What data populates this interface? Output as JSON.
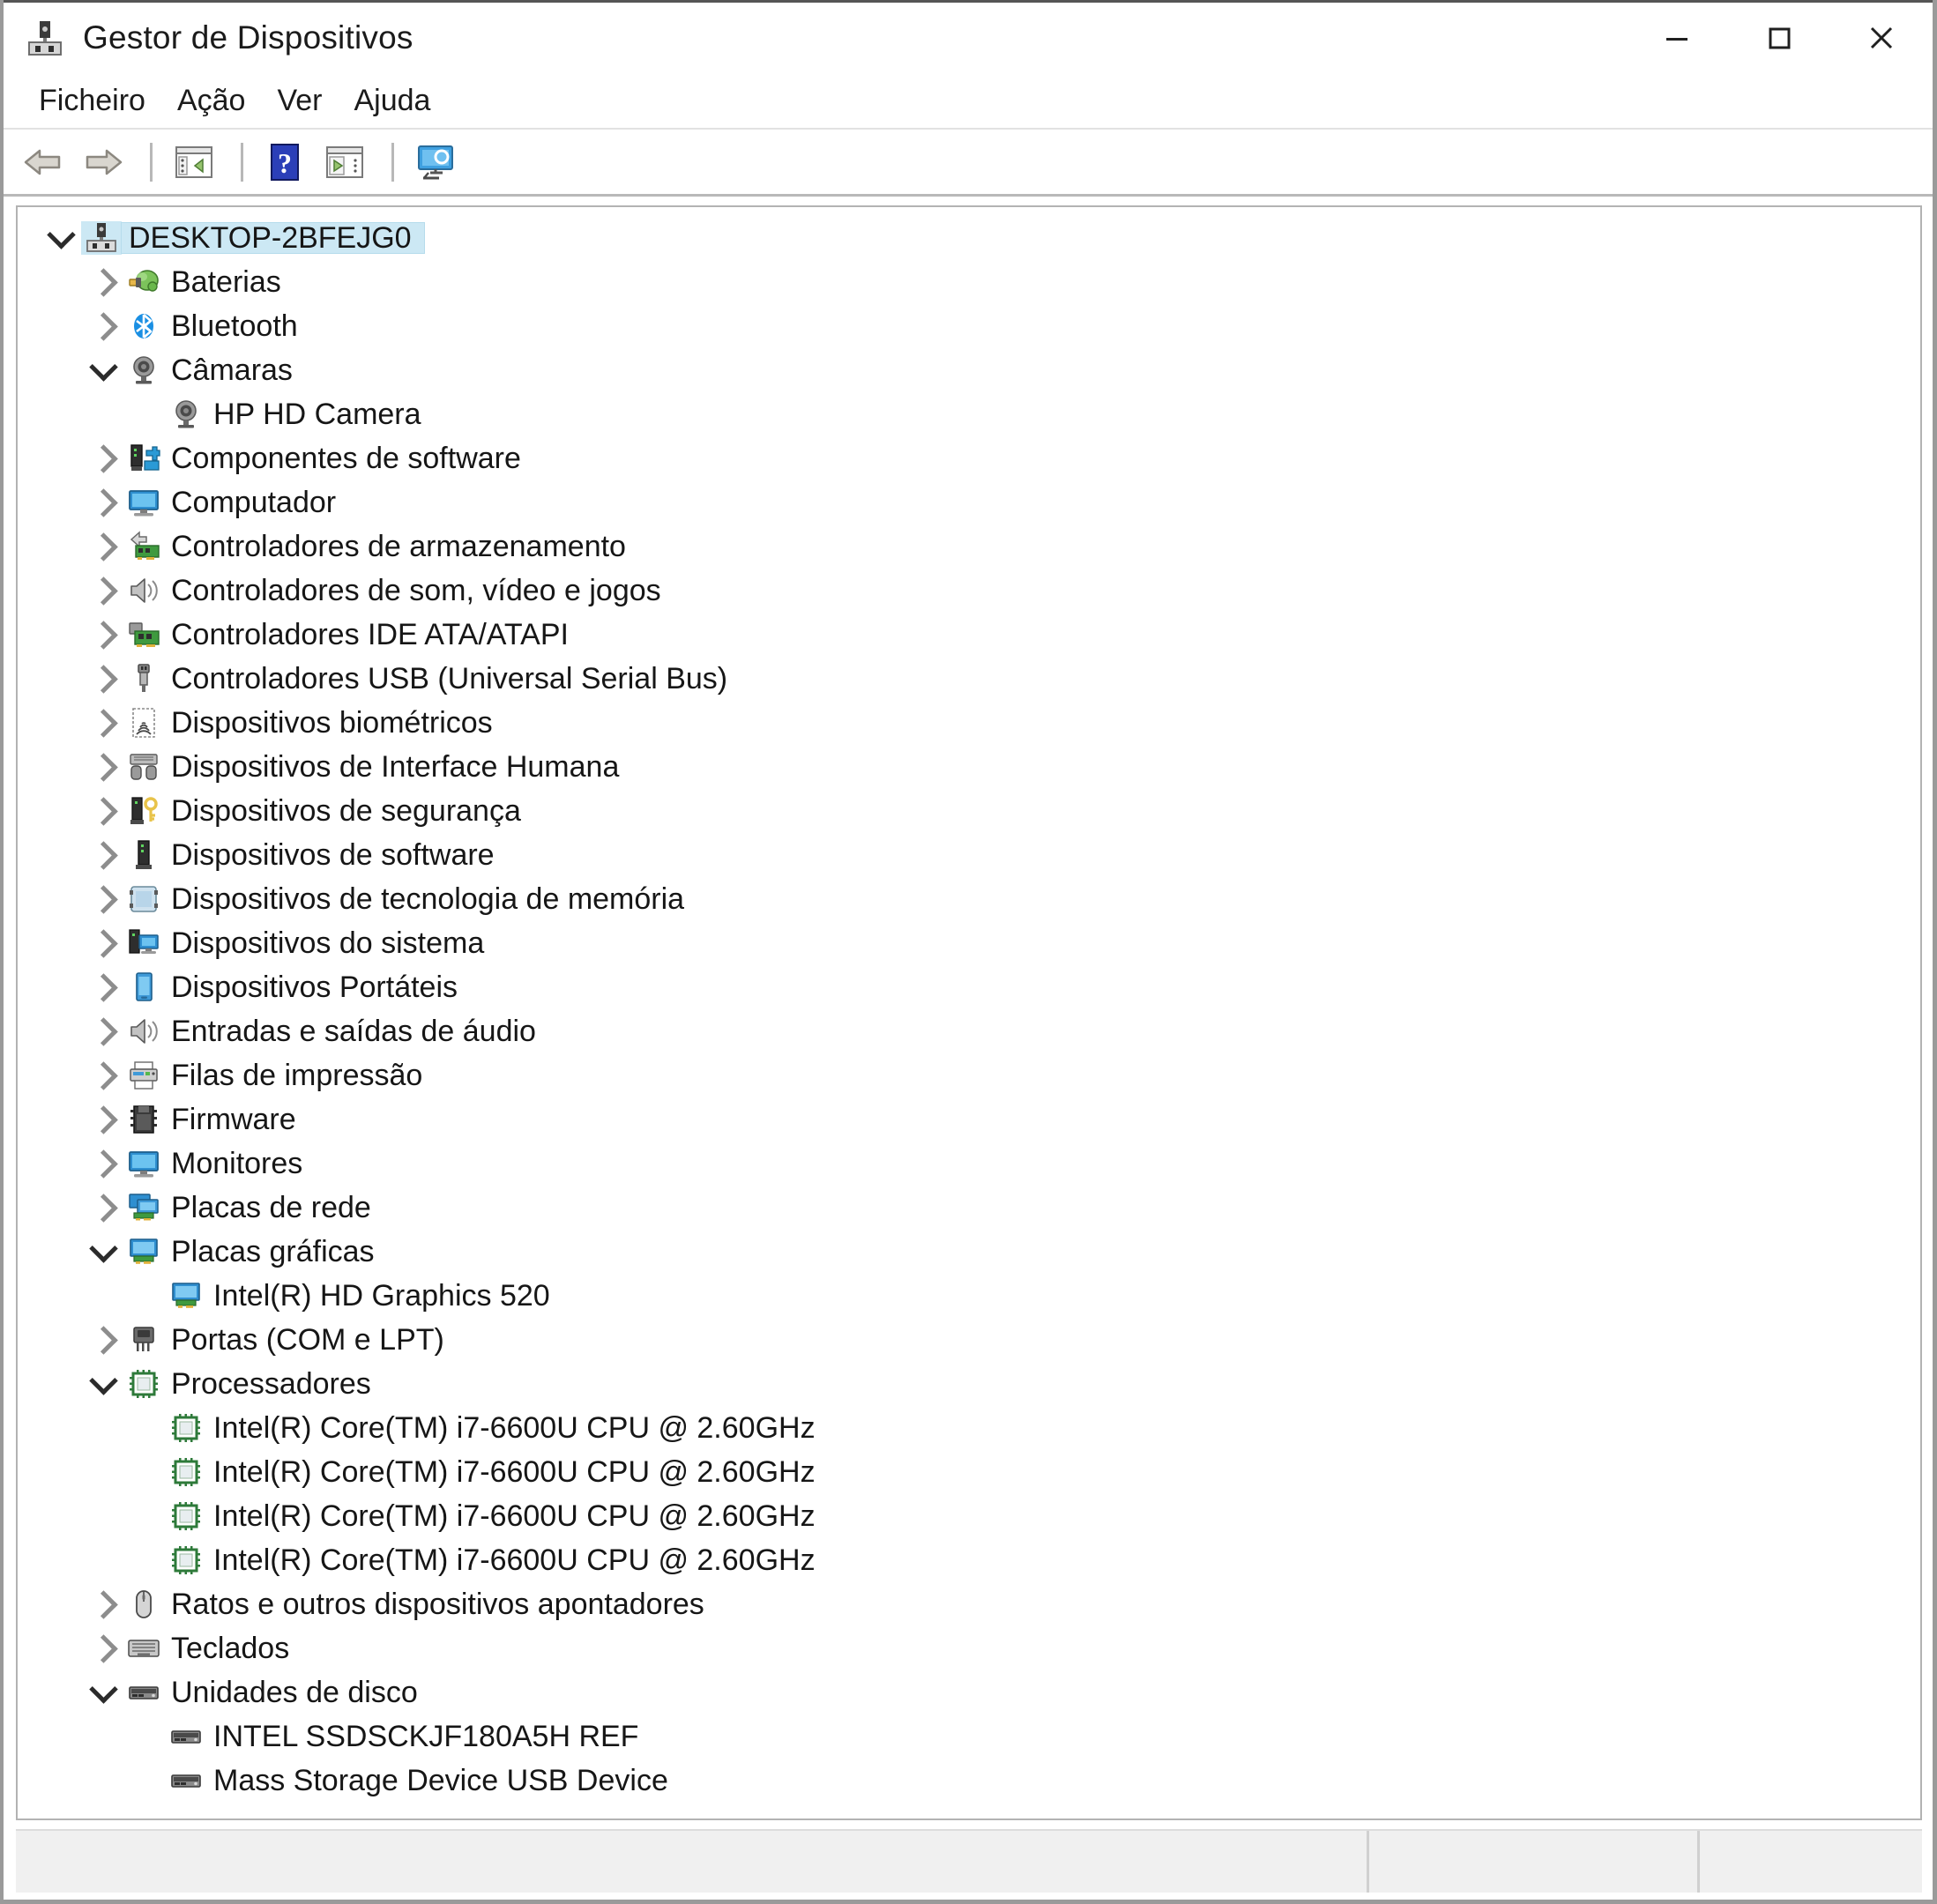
{
  "window": {
    "title": "Gestor de Dispositivos",
    "icon": "device-manager-icon",
    "controls": {
      "minimize": "minimize-icon",
      "maximize": "maximize-icon",
      "close": "close-icon"
    }
  },
  "menubar": {
    "items": [
      {
        "label": "Ficheiro"
      },
      {
        "label": "Ação"
      },
      {
        "label": "Ver"
      },
      {
        "label": "Ajuda"
      }
    ]
  },
  "toolbar": {
    "buttons": [
      {
        "name": "back-arrow-icon"
      },
      {
        "name": "forward-arrow-icon"
      },
      {
        "name": "separator"
      },
      {
        "name": "properties-pane-icon"
      },
      {
        "name": "separator"
      },
      {
        "name": "help-icon"
      },
      {
        "name": "show-pane-icon"
      },
      {
        "name": "separator"
      },
      {
        "name": "scan-hardware-changes-icon"
      }
    ]
  },
  "colors": {
    "selection": "#cce8f4",
    "accent_blue": "#0078d7",
    "help_blue": "#2b3fb8",
    "window_border": "#9a9a9a"
  },
  "tree": {
    "nodes": [
      {
        "label": "DESKTOP-2BFEJG0",
        "depth": 0,
        "state": "expanded",
        "selected": true,
        "icon": "computer-hub-icon"
      },
      {
        "label": "Baterias",
        "depth": 1,
        "state": "collapsed",
        "selected": false,
        "icon": "battery-icon"
      },
      {
        "label": "Bluetooth",
        "depth": 1,
        "state": "collapsed",
        "selected": false,
        "icon": "bluetooth-icon"
      },
      {
        "label": "Câmaras",
        "depth": 1,
        "state": "expanded",
        "selected": false,
        "icon": "camera-icon"
      },
      {
        "label": "HP HD Camera",
        "depth": 2,
        "state": "leaf",
        "selected": false,
        "icon": "camera-icon"
      },
      {
        "label": "Componentes de software",
        "depth": 1,
        "state": "collapsed",
        "selected": false,
        "icon": "software-component-icon"
      },
      {
        "label": "Computador",
        "depth": 1,
        "state": "collapsed",
        "selected": false,
        "icon": "monitor-icon"
      },
      {
        "label": "Controladores de armazenamento",
        "depth": 1,
        "state": "collapsed",
        "selected": false,
        "icon": "storage-controller-icon"
      },
      {
        "label": "Controladores de som, vídeo e jogos",
        "depth": 1,
        "state": "collapsed",
        "selected": false,
        "icon": "speaker-icon"
      },
      {
        "label": "Controladores IDE ATA/ATAPI",
        "depth": 1,
        "state": "collapsed",
        "selected": false,
        "icon": "ide-controller-icon"
      },
      {
        "label": "Controladores USB (Universal Serial Bus)",
        "depth": 1,
        "state": "collapsed",
        "selected": false,
        "icon": "usb-icon"
      },
      {
        "label": "Dispositivos biométricos",
        "depth": 1,
        "state": "collapsed",
        "selected": false,
        "icon": "fingerprint-icon"
      },
      {
        "label": "Dispositivos de Interface Humana",
        "depth": 1,
        "state": "collapsed",
        "selected": false,
        "icon": "hid-icon"
      },
      {
        "label": "Dispositivos de segurança",
        "depth": 1,
        "state": "collapsed",
        "selected": false,
        "icon": "security-key-icon"
      },
      {
        "label": "Dispositivos de software",
        "depth": 1,
        "state": "collapsed",
        "selected": false,
        "icon": "software-device-icon"
      },
      {
        "label": "Dispositivos de tecnologia de memória",
        "depth": 1,
        "state": "collapsed",
        "selected": false,
        "icon": "memory-card-icon"
      },
      {
        "label": "Dispositivos do sistema",
        "depth": 1,
        "state": "collapsed",
        "selected": false,
        "icon": "system-device-icon"
      },
      {
        "label": "Dispositivos Portáteis",
        "depth": 1,
        "state": "collapsed",
        "selected": false,
        "icon": "portable-device-icon"
      },
      {
        "label": "Entradas e saídas de áudio",
        "depth": 1,
        "state": "collapsed",
        "selected": false,
        "icon": "speaker-icon"
      },
      {
        "label": "Filas de impressão",
        "depth": 1,
        "state": "collapsed",
        "selected": false,
        "icon": "printer-icon"
      },
      {
        "label": "Firmware",
        "depth": 1,
        "state": "collapsed",
        "selected": false,
        "icon": "firmware-chip-icon"
      },
      {
        "label": "Monitores",
        "depth": 1,
        "state": "collapsed",
        "selected": false,
        "icon": "monitor-icon"
      },
      {
        "label": "Placas de rede",
        "depth": 1,
        "state": "collapsed",
        "selected": false,
        "icon": "network-adapter-icon"
      },
      {
        "label": "Placas gráficas",
        "depth": 1,
        "state": "expanded",
        "selected": false,
        "icon": "display-adapter-icon"
      },
      {
        "label": "Intel(R) HD Graphics 520",
        "depth": 2,
        "state": "leaf",
        "selected": false,
        "icon": "display-adapter-icon"
      },
      {
        "label": "Portas (COM e LPT)",
        "depth": 1,
        "state": "collapsed",
        "selected": false,
        "icon": "port-icon"
      },
      {
        "label": "Processadores",
        "depth": 1,
        "state": "expanded",
        "selected": false,
        "icon": "cpu-icon"
      },
      {
        "label": "Intel(R) Core(TM) i7-6600U CPU @ 2.60GHz",
        "depth": 2,
        "state": "leaf",
        "selected": false,
        "icon": "cpu-icon"
      },
      {
        "label": "Intel(R) Core(TM) i7-6600U CPU @ 2.60GHz",
        "depth": 2,
        "state": "leaf",
        "selected": false,
        "icon": "cpu-icon"
      },
      {
        "label": "Intel(R) Core(TM) i7-6600U CPU @ 2.60GHz",
        "depth": 2,
        "state": "leaf",
        "selected": false,
        "icon": "cpu-icon"
      },
      {
        "label": "Intel(R) Core(TM) i7-6600U CPU @ 2.60GHz",
        "depth": 2,
        "state": "leaf",
        "selected": false,
        "icon": "cpu-icon"
      },
      {
        "label": "Ratos e outros dispositivos apontadores",
        "depth": 1,
        "state": "collapsed",
        "selected": false,
        "icon": "mouse-icon"
      },
      {
        "label": "Teclados",
        "depth": 1,
        "state": "collapsed",
        "selected": false,
        "icon": "keyboard-icon"
      },
      {
        "label": "Unidades de disco",
        "depth": 1,
        "state": "expanded",
        "selected": false,
        "icon": "disk-drive-icon"
      },
      {
        "label": "INTEL SSDSCKJF180A5H REF",
        "depth": 2,
        "state": "leaf",
        "selected": false,
        "icon": "disk-drive-icon"
      },
      {
        "label": "Mass Storage Device USB Device",
        "depth": 2,
        "state": "leaf",
        "selected": false,
        "icon": "disk-drive-icon"
      }
    ]
  },
  "statusbar": {
    "panel1": "",
    "panel2": "",
    "panel3": ""
  }
}
